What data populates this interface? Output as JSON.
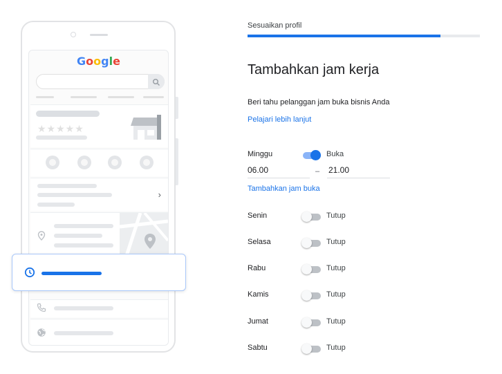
{
  "illustration": {
    "logo": [
      {
        "ch": "G",
        "color": "#4285f4"
      },
      {
        "ch": "o",
        "color": "#ea4335"
      },
      {
        "ch": "o",
        "color": "#fbbc05"
      },
      {
        "ch": "g",
        "color": "#4285f4"
      },
      {
        "ch": "l",
        "color": "#34a853"
      },
      {
        "ch": "e",
        "color": "#ea4335"
      }
    ],
    "stars": "★★★★★",
    "chevron": "›"
  },
  "progress": {
    "label": "Sesuaikan profil",
    "fraction": 0.83
  },
  "title": "Tambahkan jam kerja",
  "subtitle": "Beri tahu pelanggan jam buka bisnis Anda",
  "learn_more": "Pelajari lebih lanjut",
  "open_day": {
    "label": "Minggu",
    "state": "Buka",
    "open_time": "06.00",
    "dash": "–",
    "close_time": "21.00"
  },
  "add_hours": "Tambahkan jam buka",
  "closed_days": [
    {
      "label": "Senin",
      "state": "Tutup"
    },
    {
      "label": "Selasa",
      "state": "Tutup"
    },
    {
      "label": "Rabu",
      "state": "Tutup"
    },
    {
      "label": "Kamis",
      "state": "Tutup"
    },
    {
      "label": "Jumat",
      "state": "Tutup"
    },
    {
      "label": "Sabtu",
      "state": "Tutup"
    }
  ],
  "colors": {
    "accent": "#1a73e8",
    "toggle_on_track": "#8ab4f8",
    "toggle_off_track": "#bdc1c6"
  }
}
